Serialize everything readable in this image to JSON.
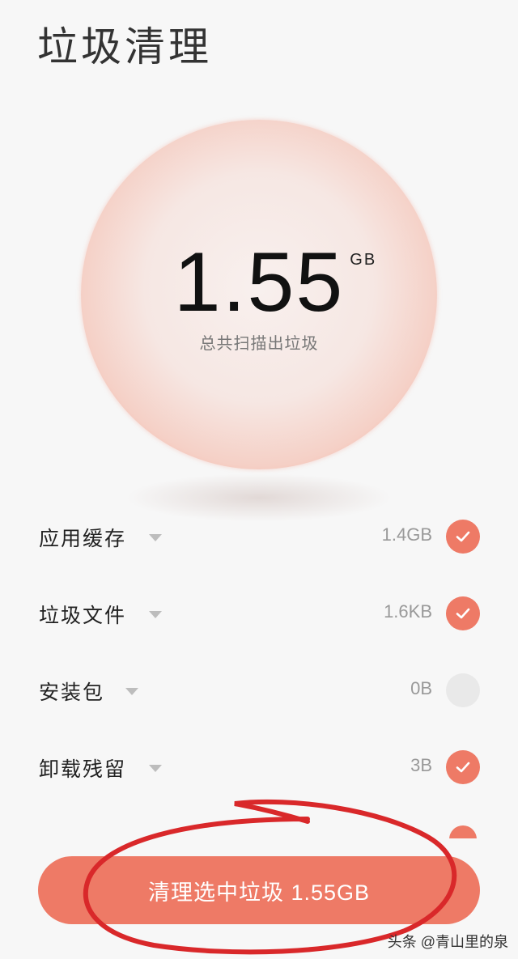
{
  "header": {
    "title": "垃圾清理"
  },
  "scan": {
    "total_value": "1.55",
    "total_unit": "GB",
    "caption": "总共扫描出垃圾"
  },
  "items": [
    {
      "label": "应用缓存",
      "size": "1.4GB",
      "checked": true
    },
    {
      "label": "垃圾文件",
      "size": "1.6KB",
      "checked": true
    },
    {
      "label": "安装包",
      "size": "0B",
      "checked": false
    },
    {
      "label": "卸载残留",
      "size": "3B",
      "checked": true
    }
  ],
  "action": {
    "clean_label": "清理选中垃圾 1.55GB"
  },
  "watermark": "头条 @青山里的泉",
  "colors": {
    "accent": "#ee7a66",
    "annotation": "#d9282a"
  }
}
